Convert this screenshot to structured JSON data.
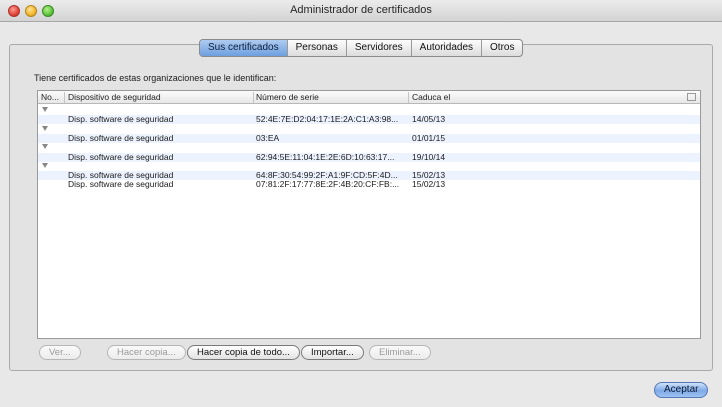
{
  "window": {
    "title": "Administrador de certificados"
  },
  "tabs": [
    {
      "label": "Sus certificados",
      "selected": true
    },
    {
      "label": "Personas",
      "selected": false
    },
    {
      "label": "Servidores",
      "selected": false
    },
    {
      "label": "Autoridades",
      "selected": false
    },
    {
      "label": "Otros",
      "selected": false
    }
  ],
  "intro_text": "Tiene certificados de estas organizaciones que le identifican:",
  "table": {
    "columns": [
      "No...",
      "Dispositivo de seguridad",
      "Número de serie",
      "Caduca el"
    ],
    "rows": [
      {
        "type": "group",
        "device": "",
        "serial": "",
        "expires": ""
      },
      {
        "type": "cert",
        "device": "Disp. software de seguridad",
        "serial": "52:4E:7E:D2:04:17:1E:2A:C1:A3:98...",
        "expires": "14/05/13"
      },
      {
        "type": "group",
        "device": "",
        "serial": "",
        "expires": ""
      },
      {
        "type": "cert",
        "device": "Disp. software de seguridad",
        "serial": "03:EA",
        "expires": "01/01/15"
      },
      {
        "type": "group",
        "device": "",
        "serial": "",
        "expires": ""
      },
      {
        "type": "cert",
        "device": "Disp. software de seguridad",
        "serial": "62:94:5E:11:04:1E:2E:6D:10:63:17...",
        "expires": "19/10/14"
      },
      {
        "type": "group",
        "device": "",
        "serial": "",
        "expires": ""
      },
      {
        "type": "cert",
        "device": "Disp. software de seguridad",
        "serial": "64:8F:30:54:99:2F:A1:9F:CD:5F:4D...",
        "expires": "15/02/13"
      },
      {
        "type": "cert",
        "device": "Disp. software de seguridad",
        "serial": "07:81:2F:17:77:8E:2F:4B:20:CF:FB:...",
        "expires": "15/02/13"
      }
    ]
  },
  "buttons": {
    "view": "Ver...",
    "backup": "Hacer copia...",
    "backup_all": "Hacer copia de todo...",
    "import": "Importar...",
    "delete": "Eliminar...",
    "ok": "Aceptar"
  }
}
